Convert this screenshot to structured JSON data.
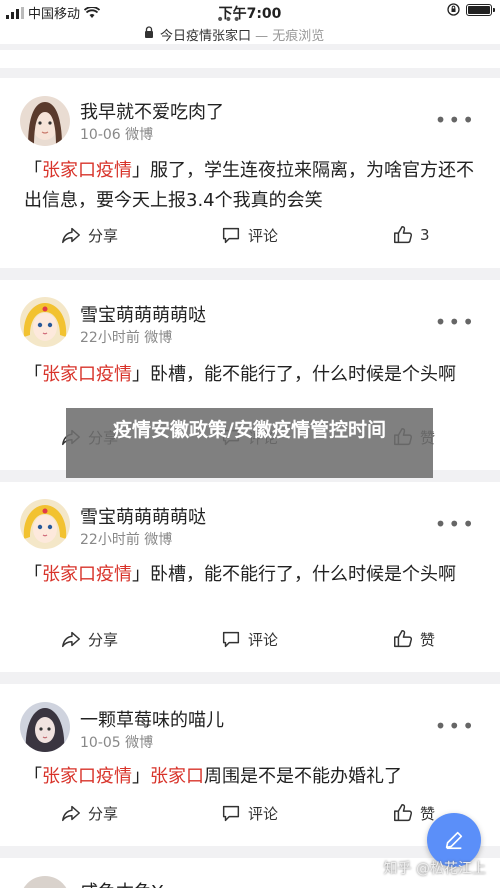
{
  "status": {
    "carrier": "中国移动",
    "time": "下午7:00"
  },
  "url_bar": {
    "title": "今日疫情张家口",
    "suffix": "— 无痕浏览"
  },
  "posts": [
    {
      "name": "我早就不爱吃肉了",
      "meta": "10-06 微博",
      "text_pre": "「",
      "text_red": "张家口疫情",
      "text_post": "」服了，学生连夜拉来隔离，为啥官方还不出信息，要今天上报3.4个我真的会笑",
      "share": "分享",
      "comment": "评论",
      "like": "3"
    },
    {
      "name": "雪宝萌萌萌萌哒",
      "meta": "22小时前 微博",
      "text_pre": "「",
      "text_red": "张家口疫情",
      "text_post": "」卧槽，能不能行了，什么时候是个头啊",
      "share": "分享",
      "comment": "评论",
      "like": "赞"
    },
    {
      "name": "雪宝萌萌萌萌哒",
      "meta": "22小时前 微博",
      "text_pre": "「",
      "text_red": "张家口疫情",
      "text_post": "」卧槽，能不能行了，什么时候是个头啊",
      "share": "分享",
      "comment": "评论",
      "like": "赞"
    },
    {
      "name": "一颗草莓味的喵儿",
      "meta": "10-05 微博",
      "text_pre": "「",
      "text_red": "张家口疫情",
      "text_mid": "」",
      "text_red2": "张家口",
      "text_post": "周围是不是不能办婚礼了",
      "share": "分享",
      "comment": "评论",
      "like": "赞"
    },
    {
      "name": "咸鱼本鱼Yo"
    }
  ],
  "overlay": {
    "text": "疫情安徽政策/安徽疫情管控时间"
  },
  "watermark": "知乎 @松花江上",
  "colors": {
    "accent_red": "#d8332a",
    "fab_blue": "#5b8ff9"
  },
  "icons": [
    "signal-icon",
    "wifi-icon",
    "lock-icon",
    "battery-icon",
    "more-icon",
    "share-icon",
    "comment-icon",
    "like-icon",
    "pencil-icon"
  ]
}
